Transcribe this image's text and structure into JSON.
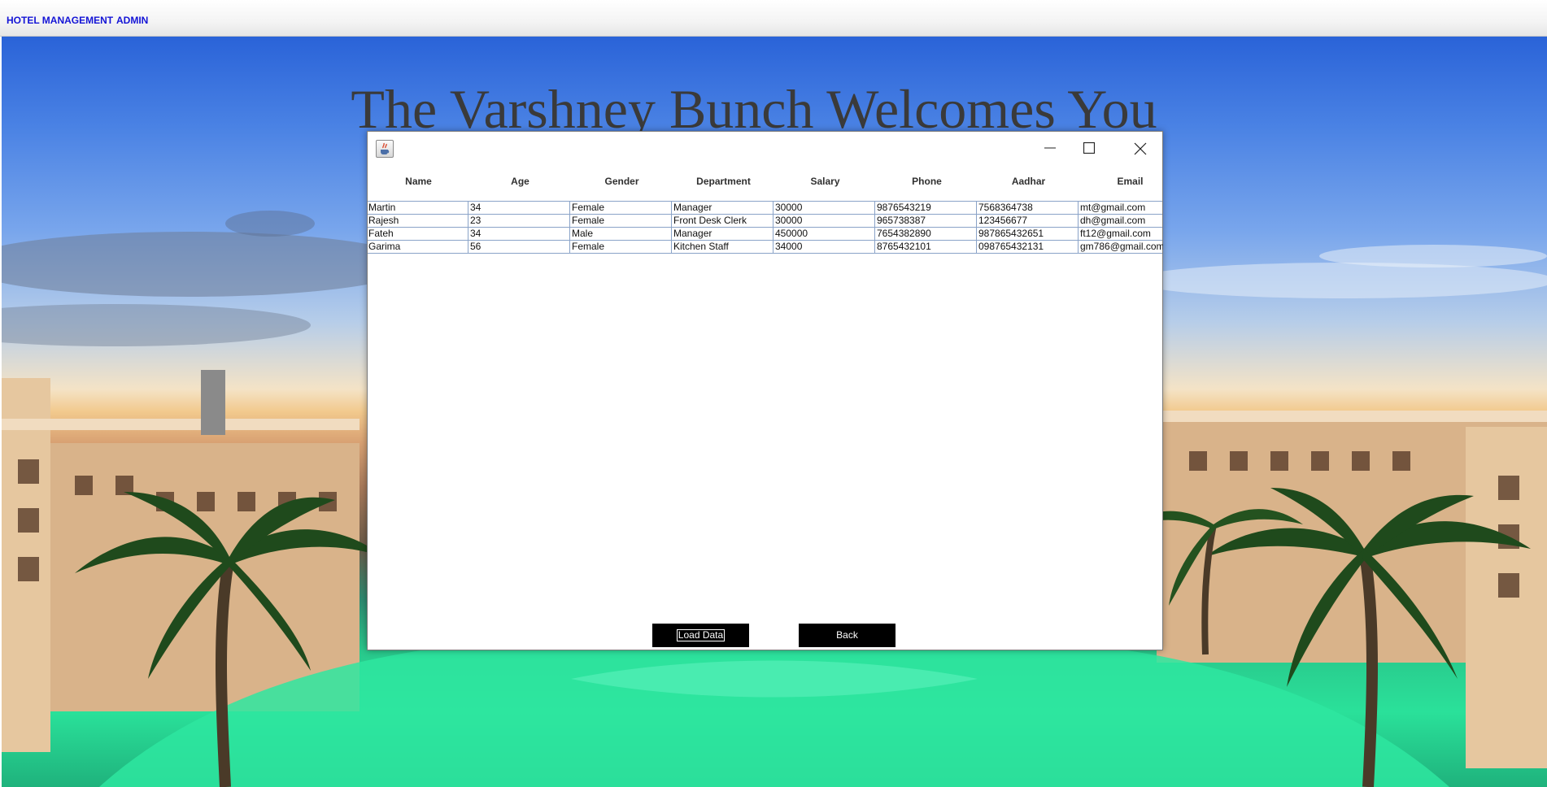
{
  "menubar": {
    "items": [
      {
        "label": "HOTEL MANAGEMENT"
      },
      {
        "label": "ADMIN"
      }
    ]
  },
  "background": {
    "heading": "The Varshney Bunch Welcomes You"
  },
  "window": {
    "icon": "java-coffee-cup-icon",
    "controls": [
      "minimize-icon",
      "maximize-icon",
      "close-icon"
    ]
  },
  "table": {
    "columns": [
      "Name",
      "Age",
      "Gender",
      "Department",
      "Salary",
      "Phone",
      "Aadhar",
      "Email"
    ],
    "rows": [
      [
        "Martin",
        "34",
        "Female",
        "Manager",
        "30000",
        "9876543219",
        "7568364738",
        "mt@gmail.com"
      ],
      [
        "Rajesh",
        "23",
        "Female",
        "Front Desk Clerk",
        "30000",
        "965738387",
        "123456677",
        "dh@gmail.com"
      ],
      [
        "Fateh",
        "34",
        "Male",
        "Manager",
        "450000",
        "7654382890",
        "987865432651",
        "ft12@gmail.com"
      ],
      [
        "Garima",
        "56",
        "Female",
        "Kitchen Staff",
        "34000",
        "8765432101",
        "098765432131",
        "gm786@gmail.com"
      ]
    ]
  },
  "buttons": {
    "load": "Load Data",
    "back": "Back"
  },
  "colors": {
    "menu_text": "#1414d6",
    "button_bg": "#000000",
    "grid_line": "#8aa3c8"
  }
}
